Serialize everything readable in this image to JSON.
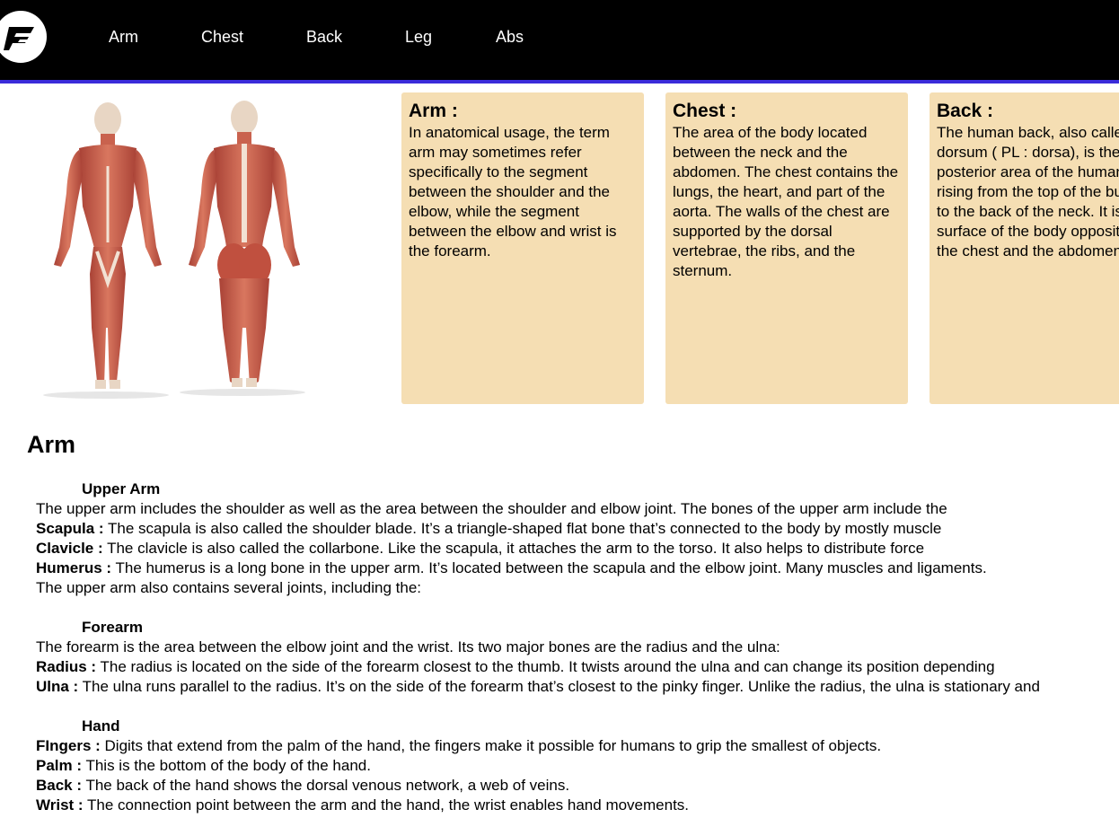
{
  "nav": {
    "logo_alt": "F",
    "items": [
      "Arm",
      "Chest",
      "Back",
      "Leg",
      "Abs"
    ]
  },
  "colors": {
    "topbar": "#000000",
    "accent_border": "#3a2bd9",
    "card_bg": "#f5deb3"
  },
  "cards": [
    {
      "title": "Arm :",
      "text": "In anatomical usage, the term arm may sometimes refer specifically to the segment between the shoulder and the elbow, while the segment between the elbow and wrist is the forearm."
    },
    {
      "title": "Chest :",
      "text": "The area of the body located between the neck and the abdomen. The chest contains the lungs, the heart, and part of the aorta. The walls of the chest are supported by the dorsal vertebrae, the ribs, and the sternum."
    },
    {
      "title": "Back :",
      "text": "The human back, also called the dorsum ( PL : dorsa), is the large posterior area of the human body, rising from the top of the buttocks to the back of the neck. It is the surface of the body opposite from the chest and the abdomen."
    }
  ],
  "section_title": "Arm",
  "upper_arm": {
    "title": "Upper Arm",
    "intro": "The upper arm includes the shoulder as well as the area between the shoulder and elbow joint. The bones of the upper arm include the",
    "items": [
      {
        "term": "Scapula :",
        "text": " The scapula is also called the shoulder blade. It’s a triangle-shaped flat bone that’s connected to the body by mostly muscle"
      },
      {
        "term": "Clavicle :",
        "text": "  The clavicle is also called the collarbone. Like the scapula, it attaches the arm to the torso. It also helps to distribute force"
      },
      {
        "term": "Humerus :",
        "text": " The humerus is a long bone in the upper arm. It’s located between the scapula and the elbow joint. Many muscles and ligaments."
      }
    ],
    "outro": "The upper arm also contains several joints, including the:"
  },
  "forearm": {
    "title": "Forearm",
    "intro": "The forearm is the area between the elbow joint and the wrist. Its two major bones are the radius and the ulna:",
    "items": [
      {
        "term": "Radius :",
        "text": " The radius is located on the side of the forearm closest to the thumb. It twists around the ulna and can change its position depending"
      },
      {
        "term": "Ulna :",
        "text": " The ulna runs parallel to the radius. It’s on the side of the forearm that’s closest to the pinky finger. Unlike the radius, the ulna is stationary and"
      }
    ]
  },
  "hand": {
    "title": "Hand",
    "items": [
      {
        "term": "FIngers :",
        "text": " Digits that extend from the palm of the hand, the fingers make it possible for humans to grip the smallest of objects."
      },
      {
        "term": "Palm :",
        "text": " This is the bottom of the body of the hand."
      },
      {
        "term": "Back :",
        "text": " The back of the hand shows the dorsal venous network, a web of veins."
      },
      {
        "term": "Wrist :",
        "text": " The connection point between the arm and the hand, the wrist enables hand movements."
      }
    ]
  }
}
